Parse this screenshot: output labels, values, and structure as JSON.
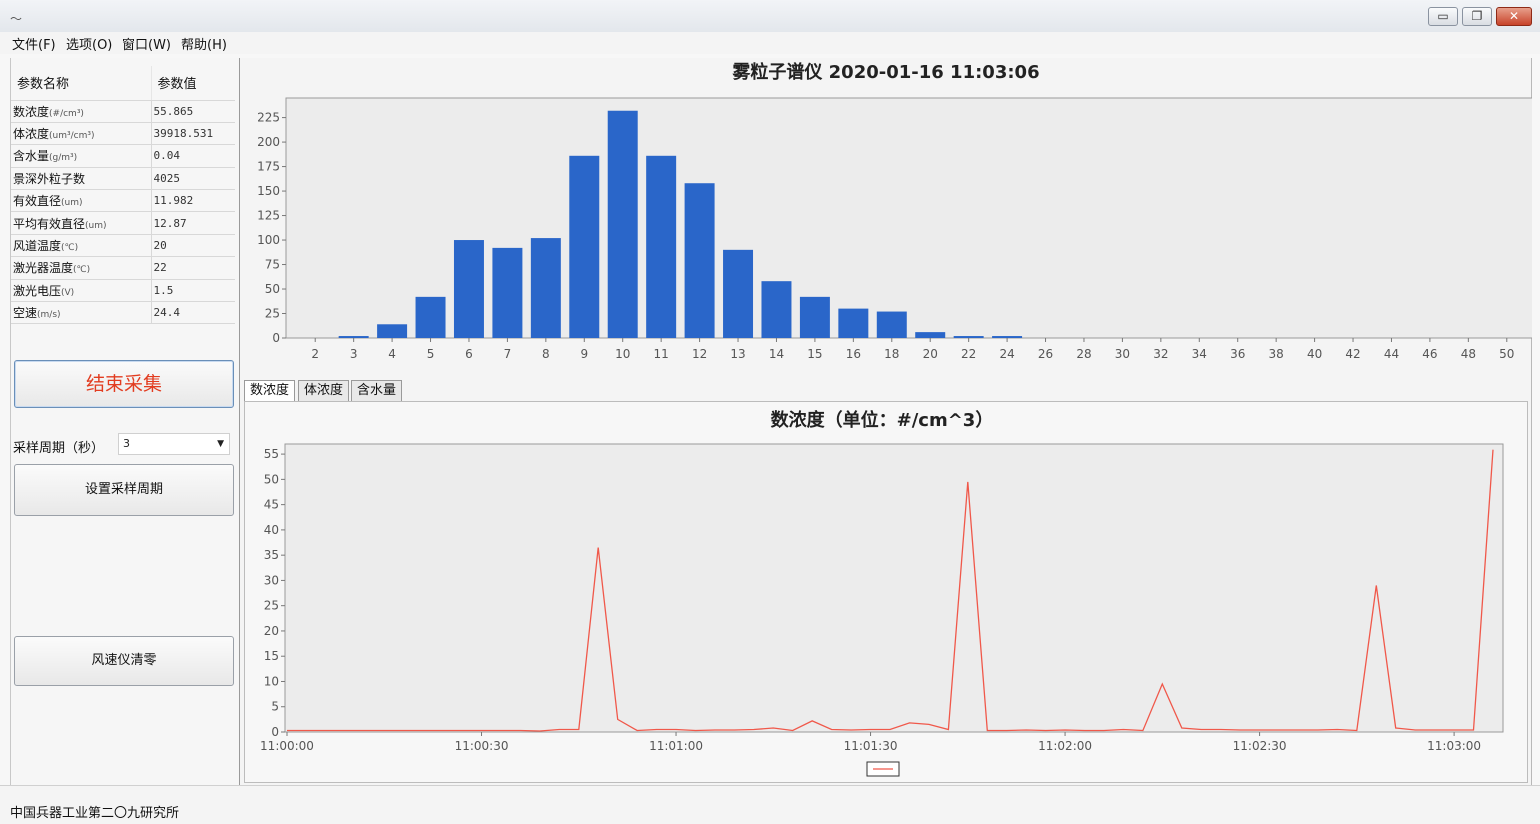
{
  "window": {
    "logo_glyph": "～",
    "buttons": {
      "minimize": "▭",
      "maximize": "❐",
      "close": "✕"
    }
  },
  "menu": [
    "文件(F)",
    "选项(O)",
    "窗口(W)",
    "帮助(H)"
  ],
  "param_table": {
    "headers": [
      "参数名称",
      "参数值"
    ],
    "rows": [
      {
        "name": "数浓度",
        "unit": "(#/cm³)",
        "value": "55.865"
      },
      {
        "name": "体浓度",
        "unit": "(um³/cm³)",
        "value": "39918.531"
      },
      {
        "name": "含水量",
        "unit": "(g/m³)",
        "value": "0.04"
      },
      {
        "name": "景深外粒子数",
        "unit": "",
        "value": "4025"
      },
      {
        "name": "有效直径",
        "unit": "(um)",
        "value": "11.982"
      },
      {
        "name": "平均有效直径",
        "unit": "(um)",
        "value": "12.87"
      },
      {
        "name": "风道温度",
        "unit": "(℃)",
        "value": "20"
      },
      {
        "name": "激光器温度",
        "unit": "(℃)",
        "value": "22"
      },
      {
        "name": "激光电压",
        "unit": "(V)",
        "value": "1.5"
      },
      {
        "name": "空速",
        "unit": "(m/s)",
        "value": "24.4"
      }
    ]
  },
  "controls": {
    "stop_label": "结束采集",
    "period_label": "采样周期（秒）",
    "period_value": "3",
    "set_period_label": "设置采样周期",
    "reset_label": "风速仪清零"
  },
  "tabs": [
    "数浓度",
    "体浓度",
    "含水量"
  ],
  "footer": "中国兵器工业第二〇九研究所",
  "colors": {
    "bar": "#2a66c9",
    "line": "#f0584a",
    "plot_bg": "#ececec",
    "stop_text": "#e23c20"
  },
  "chart_data": [
    {
      "type": "bar",
      "title": "雾粒子谱仪 2020-01-16 11:03:06",
      "categories": [
        "2",
        "3",
        "4",
        "5",
        "6",
        "7",
        "8",
        "9",
        "10",
        "11",
        "12",
        "13",
        "14",
        "15",
        "16",
        "18",
        "20",
        "22",
        "24",
        "26",
        "28",
        "30",
        "32",
        "34",
        "36",
        "38",
        "40",
        "42",
        "44",
        "46",
        "48",
        "50"
      ],
      "values": [
        0,
        2,
        14,
        42,
        100,
        92,
        102,
        186,
        232,
        186,
        158,
        90,
        58,
        42,
        30,
        27,
        6,
        2,
        2,
        0,
        0,
        0,
        0,
        0,
        0,
        0,
        0,
        0,
        0,
        0,
        0,
        0
      ],
      "yticks": [
        0,
        25,
        50,
        75,
        100,
        125,
        150,
        175,
        200,
        225
      ],
      "ylim": [
        0,
        245
      ],
      "grid": false
    },
    {
      "type": "line",
      "title": "数浓度（单位：#/cm^3）",
      "x_ticks": [
        "11:00:00",
        "11:00:30",
        "11:01:00",
        "11:01:30",
        "11:02:00",
        "11:02:30",
        "11:03:00"
      ],
      "x_seconds_per_tick": 30,
      "yticks": [
        0,
        5,
        10,
        15,
        20,
        25,
        30,
        35,
        40,
        45,
        50,
        55
      ],
      "ylim": [
        0,
        57
      ],
      "grid": false,
      "legend": "bottom",
      "series": [
        {
          "x": [
            "11:00:00",
            "11:00:03",
            "11:00:06",
            "11:00:09",
            "11:00:12",
            "11:00:15",
            "11:00:18",
            "11:00:21",
            "11:00:24",
            "11:00:27",
            "11:00:30",
            "11:00:33",
            "11:00:36",
            "11:00:39",
            "11:00:42",
            "11:00:45",
            "11:00:48",
            "11:00:51",
            "11:00:54",
            "11:00:57",
            "11:01:00",
            "11:01:03",
            "11:01:06",
            "11:01:09",
            "11:01:12",
            "11:01:15",
            "11:01:18",
            "11:01:21",
            "11:01:24",
            "11:01:27",
            "11:01:30",
            "11:01:33",
            "11:01:36",
            "11:01:39",
            "11:01:42",
            "11:01:45",
            "11:01:48",
            "11:01:51",
            "11:01:54",
            "11:01:57",
            "11:02:00",
            "11:02:03",
            "11:02:06",
            "11:02:09",
            "11:02:12",
            "11:02:15",
            "11:02:18",
            "11:02:21",
            "11:02:24",
            "11:02:27",
            "11:02:30",
            "11:02:33",
            "11:02:36",
            "11:02:39",
            "11:02:42",
            "11:02:45",
            "11:02:48",
            "11:02:51",
            "11:02:54",
            "11:02:57",
            "11:03:00",
            "11:03:03",
            "11:03:06"
          ],
          "values": [
            0.3,
            0.3,
            0.3,
            0.3,
            0.3,
            0.3,
            0.3,
            0.3,
            0.3,
            0.3,
            0.3,
            0.3,
            0.3,
            0.2,
            0.5,
            0.5,
            36.5,
            2.5,
            0.3,
            0.5,
            0.5,
            0.3,
            0.4,
            0.4,
            0.5,
            0.8,
            0.3,
            2.2,
            0.5,
            0.4,
            0.5,
            0.5,
            1.8,
            1.5,
            0.5,
            49.5,
            0.3,
            0.3,
            0.4,
            0.3,
            0.4,
            0.3,
            0.3,
            0.5,
            0.3,
            9.5,
            0.8,
            0.5,
            0.5,
            0.4,
            0.4,
            0.4,
            0.4,
            0.4,
            0.5,
            0.3,
            29,
            0.8,
            0.4,
            0.4,
            0.4,
            0.4,
            55.865
          ]
        }
      ]
    }
  ]
}
